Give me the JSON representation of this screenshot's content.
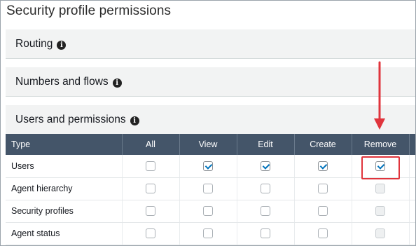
{
  "page": {
    "title": "Security profile permissions"
  },
  "sections": [
    {
      "label": "Routing",
      "icon": "info-icon"
    },
    {
      "label": "Numbers and flows",
      "icon": "info-icon"
    },
    {
      "label": "Users and permissions",
      "icon": "info-icon"
    }
  ],
  "table": {
    "columns": [
      "Type",
      "All",
      "View",
      "Edit",
      "Create",
      "Remove"
    ],
    "rows": [
      {
        "type": "Users",
        "all": false,
        "view": true,
        "edit": true,
        "create": true,
        "remove": true,
        "remove_disabled": false
      },
      {
        "type": "Agent hierarchy",
        "all": false,
        "view": false,
        "edit": false,
        "create": false,
        "remove": false,
        "remove_disabled": true
      },
      {
        "type": "Security profiles",
        "all": false,
        "view": false,
        "edit": false,
        "create": false,
        "remove": false,
        "remove_disabled": true
      },
      {
        "type": "Agent status",
        "all": false,
        "view": false,
        "edit": false,
        "create": false,
        "remove": false,
        "remove_disabled": true
      }
    ]
  },
  "annotation": {
    "highlight_color": "#e0343c",
    "target": "Users / Remove checkbox"
  },
  "colors": {
    "header_bg": "#445569",
    "section_bg": "#f2f3f3",
    "check_color": "#0073bb"
  }
}
